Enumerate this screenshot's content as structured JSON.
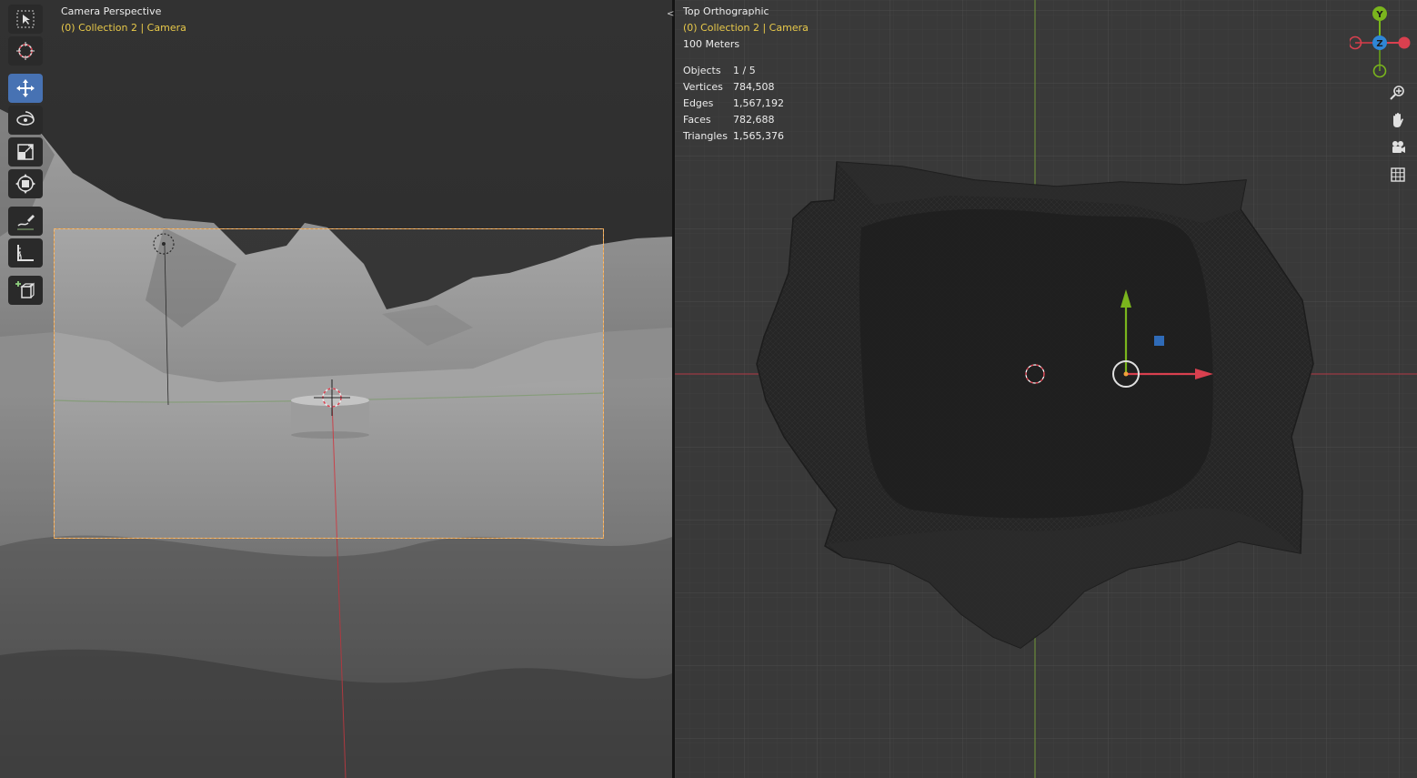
{
  "left_viewport": {
    "view_name": "Camera Perspective",
    "collection_label": "(0) Collection 2 | Camera"
  },
  "toolbar": {
    "tools": [
      {
        "name": "select-box",
        "icon": "select-box-icon",
        "active": false
      },
      {
        "name": "cursor",
        "icon": "cursor-icon",
        "active": false
      },
      {
        "name": "move",
        "icon": "move-icon",
        "active": true
      },
      {
        "name": "rotate",
        "icon": "rotate-icon",
        "active": false
      },
      {
        "name": "scale",
        "icon": "scale-icon",
        "active": false
      },
      {
        "name": "transform",
        "icon": "transform-icon",
        "active": false
      },
      {
        "name": "annotate",
        "icon": "annotate-icon",
        "active": false
      },
      {
        "name": "measure",
        "icon": "measure-icon",
        "active": false
      },
      {
        "name": "add-cube",
        "icon": "add-cube-icon",
        "active": false
      }
    ]
  },
  "divider": {
    "arrows": "<>"
  },
  "right_viewport": {
    "view_name": "Top Orthographic",
    "collection_label": "(0) Collection 2 | Camera",
    "scale_label": "100 Meters",
    "stats": [
      {
        "label": "Objects",
        "value": "1 / 5"
      },
      {
        "label": "Vertices",
        "value": "784,508"
      },
      {
        "label": "Edges",
        "value": "1,567,192"
      },
      {
        "label": "Faces",
        "value": "782,688"
      },
      {
        "label": "Triangles",
        "value": "1,565,376"
      }
    ],
    "gizmo": {
      "y": "Y",
      "z": "Z"
    },
    "nav_buttons": [
      "zoom-icon",
      "pan-hand-icon",
      "camera-view-icon",
      "ortho-grid-icon"
    ]
  },
  "colors": {
    "accent_blue": "#4772b3",
    "overlay_yellow": "#e8c94a",
    "axis_red": "#d9404f",
    "axis_green": "#7ab51d",
    "axis_blue": "#2f86d6",
    "camera_frame": "#e8a04a"
  }
}
